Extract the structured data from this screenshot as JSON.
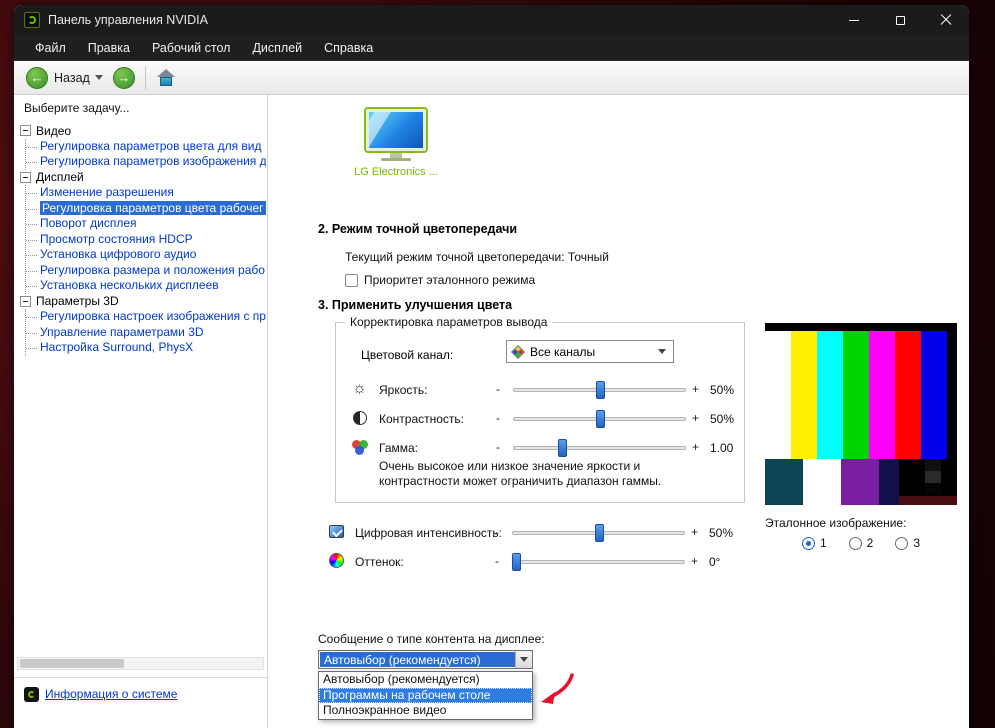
{
  "window": {
    "title": "Панель управления NVIDIA",
    "menu_items": [
      "Файл",
      "Правка",
      "Рабочий стол",
      "Дисплей",
      "Справка"
    ],
    "toolbar": {
      "back_label": "Назад"
    }
  },
  "icons": {
    "back_arrow": "←",
    "forward_arrow": "→",
    "brightness": "☼"
  },
  "sidebar": {
    "header": "Выберите задачу...",
    "tree": {
      "roots": [
        {
          "label": "Видео",
          "children": [
            {
              "label": "Регулировка параметров цвета для вид"
            },
            {
              "label": "Регулировка параметров изображения д"
            }
          ]
        },
        {
          "label": "Дисплей",
          "children": [
            {
              "label": "Изменение разрешения"
            },
            {
              "label": "Регулировка параметров цвета рабочег",
              "selected": true
            },
            {
              "label": "Поворот дисплея"
            },
            {
              "label": "Просмотр состояния HDCP"
            },
            {
              "label": "Установка цифрового аудио"
            },
            {
              "label": "Регулировка размера и положения рабо"
            },
            {
              "label": "Установка нескольких дисплеев"
            }
          ]
        },
        {
          "label": "Параметры 3D",
          "children": [
            {
              "label": "Регулировка настроек изображения с пр"
            },
            {
              "label": "Управление параметрами 3D"
            },
            {
              "label": "Настройка Surround, PhysX"
            }
          ]
        }
      ]
    },
    "footer_link": "Информация о системе"
  },
  "content": {
    "display": {
      "name": "LG Electronics ..."
    },
    "section2": {
      "title": "2. Режим точной цветопередачи",
      "current_mode_text": "Текущий режим точной цветопередачи: Точный",
      "checkbox_label": "Приоритет эталонного режима",
      "checkbox_checked": false
    },
    "section3": {
      "title": "3. Применить улучшения цвета",
      "group_title": "Корректировка параметров вывода",
      "color_channel_label": "Цветовой канал:",
      "color_channel_value": "Все каналы",
      "minus": "-",
      "plus": "+",
      "sliders": [
        {
          "name": "brightness",
          "label": "Яркость:",
          "value": "50%",
          "position_pct": 50
        },
        {
          "name": "contrast",
          "label": "Контрастность:",
          "value": "50%",
          "position_pct": 50
        },
        {
          "name": "gamma",
          "label": "Гамма:",
          "value": "1.00",
          "position_pct": 28
        }
      ],
      "warning": "Очень высокое или низкое значение яркости и контрастности может ограничить диапазон гаммы.",
      "extra_sliders": [
        {
          "name": "digital-vibrance",
          "label": "Цифровая интенсивность:",
          "value": "50%",
          "position_pct": 50
        },
        {
          "name": "hue",
          "label": "Оттенок:",
          "value": "0°",
          "position_pct": 2
        }
      ]
    },
    "content_type": {
      "label": "Сообщение о типе контента на дисплее:",
      "selected_value": "Автовыбор (рекомендуется)",
      "options": [
        "Автовыбор (рекомендуется)",
        "Программы на рабочем столе",
        "Полноэкранное видео"
      ],
      "highlighted_option": "Программы на рабочем столе"
    },
    "reference": {
      "label": "Эталонное изображение:",
      "options": [
        "1",
        "2",
        "3"
      ],
      "selected": "1"
    }
  },
  "colors": {
    "nvidia_green": "#76b900",
    "selection_blue": "#2a6cd4",
    "link_blue": "#0038cf",
    "annotation_red": "#e8112d",
    "reference_bars_top": [
      "#ffffff",
      "#fdf000",
      "#00ffff",
      "#00d400",
      "#ff00ff",
      "#ff0000",
      "#0000ee",
      "#000000"
    ],
    "reference_bars_bottom": [
      "#0e4458",
      "#ffffff",
      "#7a1fa2",
      "#10104a",
      "#000000",
      "#4a0e10"
    ]
  }
}
